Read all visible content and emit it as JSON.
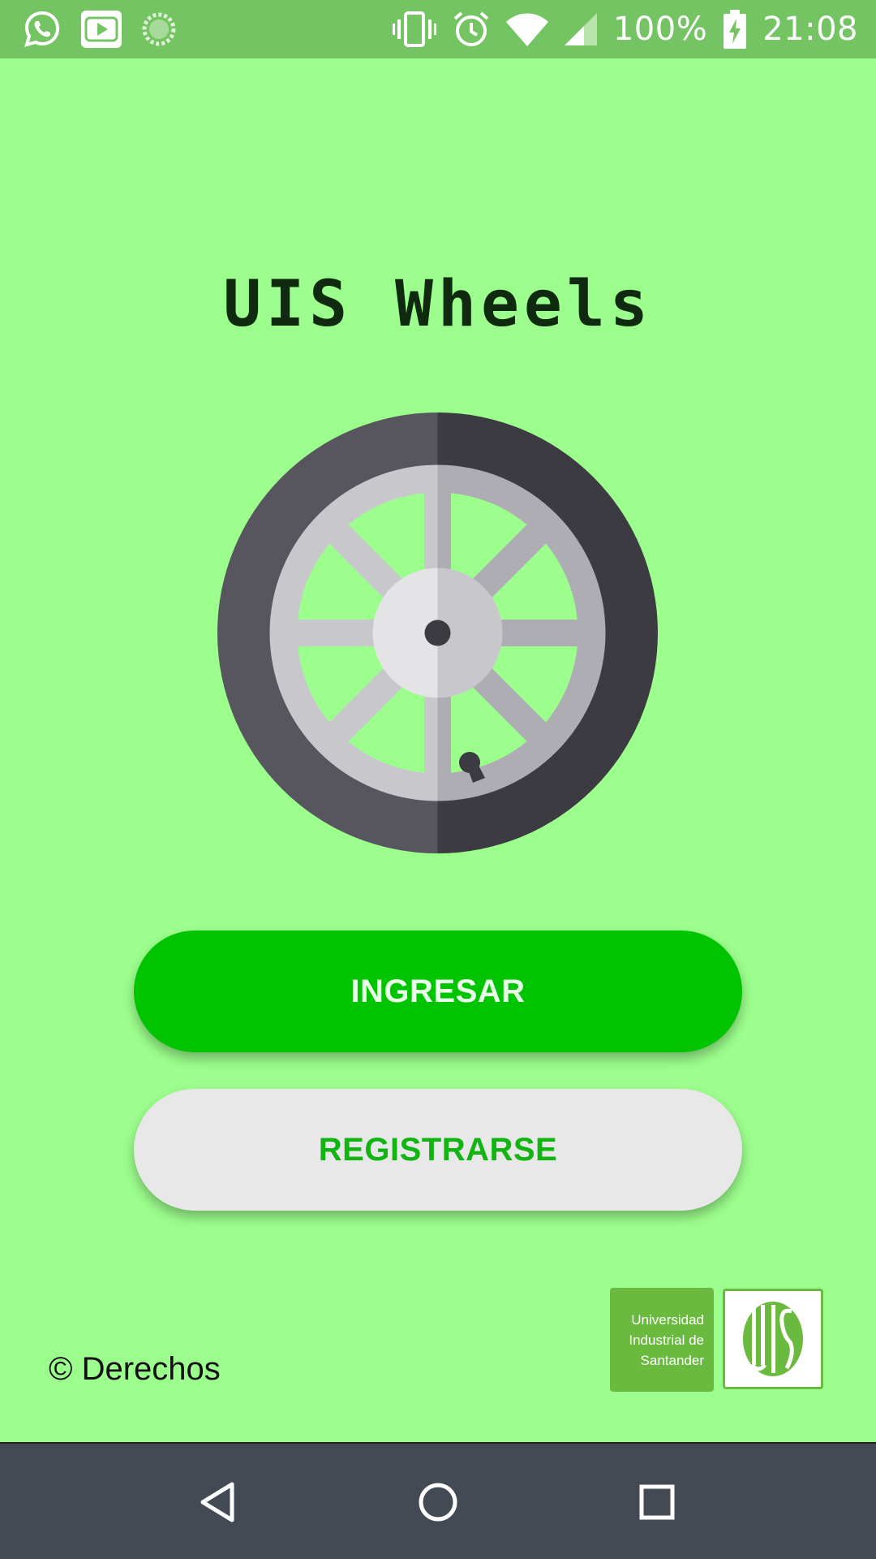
{
  "status_bar": {
    "battery_percent": "100%",
    "time": "21:08",
    "icons": [
      "whatsapp-icon",
      "youtube-icon",
      "loading-icon",
      "vibrate-icon",
      "alarm-icon",
      "wifi-icon",
      "cell-signal-icon",
      "battery-charging-icon"
    ]
  },
  "app": {
    "title": "UIS Wheels",
    "hero_icon": "wheel-icon"
  },
  "buttons": {
    "login_label": "INGRESAR",
    "register_label": "REGISTRARSE"
  },
  "footer": {
    "copyright": "© Derechos",
    "logo_text": "Universidad\nIndustrial de\nSantander"
  },
  "nav_bar": {
    "icons": [
      "back-icon",
      "home-icon",
      "recents-icon"
    ]
  },
  "colors": {
    "background": "#9cfe8c",
    "status_bar": "#74c463",
    "primary_button": "#00c400",
    "secondary_button": "#e8e8e8",
    "secondary_button_text": "#12b412",
    "nav_bar": "#434a54",
    "logo_green": "#6aba3f"
  }
}
